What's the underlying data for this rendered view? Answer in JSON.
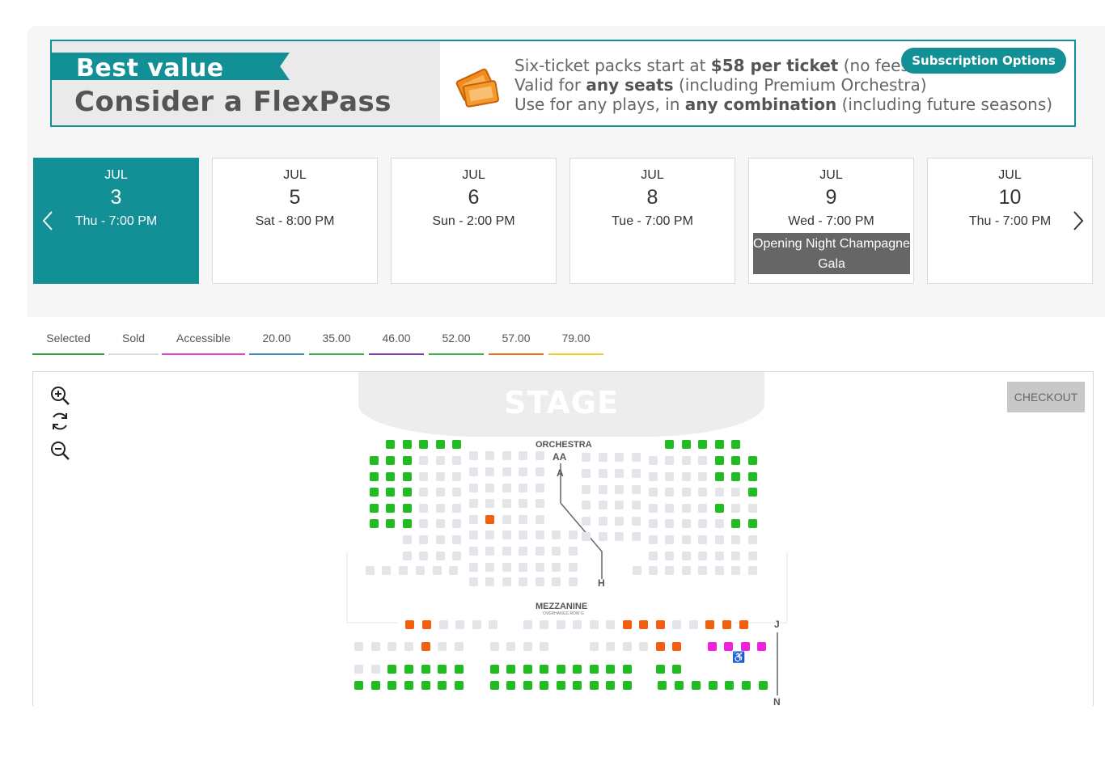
{
  "banner": {
    "headline": "Best value",
    "title": "Consider a FlexPass",
    "line1_a": "Six-ticket packs start at ",
    "line1_b": "$58 per ticket",
    "line1_c": " (no fees!)",
    "line2_a": "Valid for ",
    "line2_b": "any seats",
    "line2_c": " (including Premium Orchestra)",
    "line3_a": "Use for any plays, in ",
    "line3_b": "any combination",
    "line3_c": " (including future seasons)",
    "subscription_button": "Subscription Options",
    "ticket_icon": "ticket-icon"
  },
  "dates": [
    {
      "month": "JUL",
      "day": "3",
      "time": "Thu - 7:00 PM",
      "selected": true
    },
    {
      "month": "JUL",
      "day": "5",
      "time": "Sat - 8:00 PM"
    },
    {
      "month": "JUL",
      "day": "6",
      "time": "Sun - 2:00 PM"
    },
    {
      "month": "JUL",
      "day": "8",
      "time": "Tue - 7:00 PM"
    },
    {
      "month": "JUL",
      "day": "9",
      "time": "Wed - 7:00 PM",
      "badge": "Opening Night Champagne Gala"
    },
    {
      "month": "JUL",
      "day": "10",
      "time": "Thu - 7:00 PM"
    }
  ],
  "legend": [
    {
      "label": "Selected",
      "color": "#2e9e3e"
    },
    {
      "label": "Sold",
      "color": "#dddddd"
    },
    {
      "label": "Accessible",
      "color": "#e040c8"
    },
    {
      "label": "20.00",
      "color": "#3a8fc0"
    },
    {
      "label": "35.00",
      "color": "#3aae4a"
    },
    {
      "label": "46.00",
      "color": "#7a3ab8"
    },
    {
      "label": "52.00",
      "color": "#3aae4a"
    },
    {
      "label": "57.00",
      "color": "#e8711e"
    },
    {
      "label": "79.00",
      "color": "#f0d02a"
    }
  ],
  "map": {
    "stage": "STAGE",
    "checkout": "CHECKOUT",
    "orchestra": "ORCHESTRA",
    "row_aa": "AA",
    "row_a": "A",
    "row_h": "H",
    "mezzanine": "MEZZANINE",
    "mezz_note": "OVERHANGS ROW G",
    "row_j": "J",
    "row_n": "N",
    "accessible_symbol": "♿"
  },
  "colors": {
    "teal": "#138f96",
    "available": "#22bb22",
    "sold": "#e3e5ea",
    "accessible": "#ee22dd",
    "price57": "#f06010"
  }
}
